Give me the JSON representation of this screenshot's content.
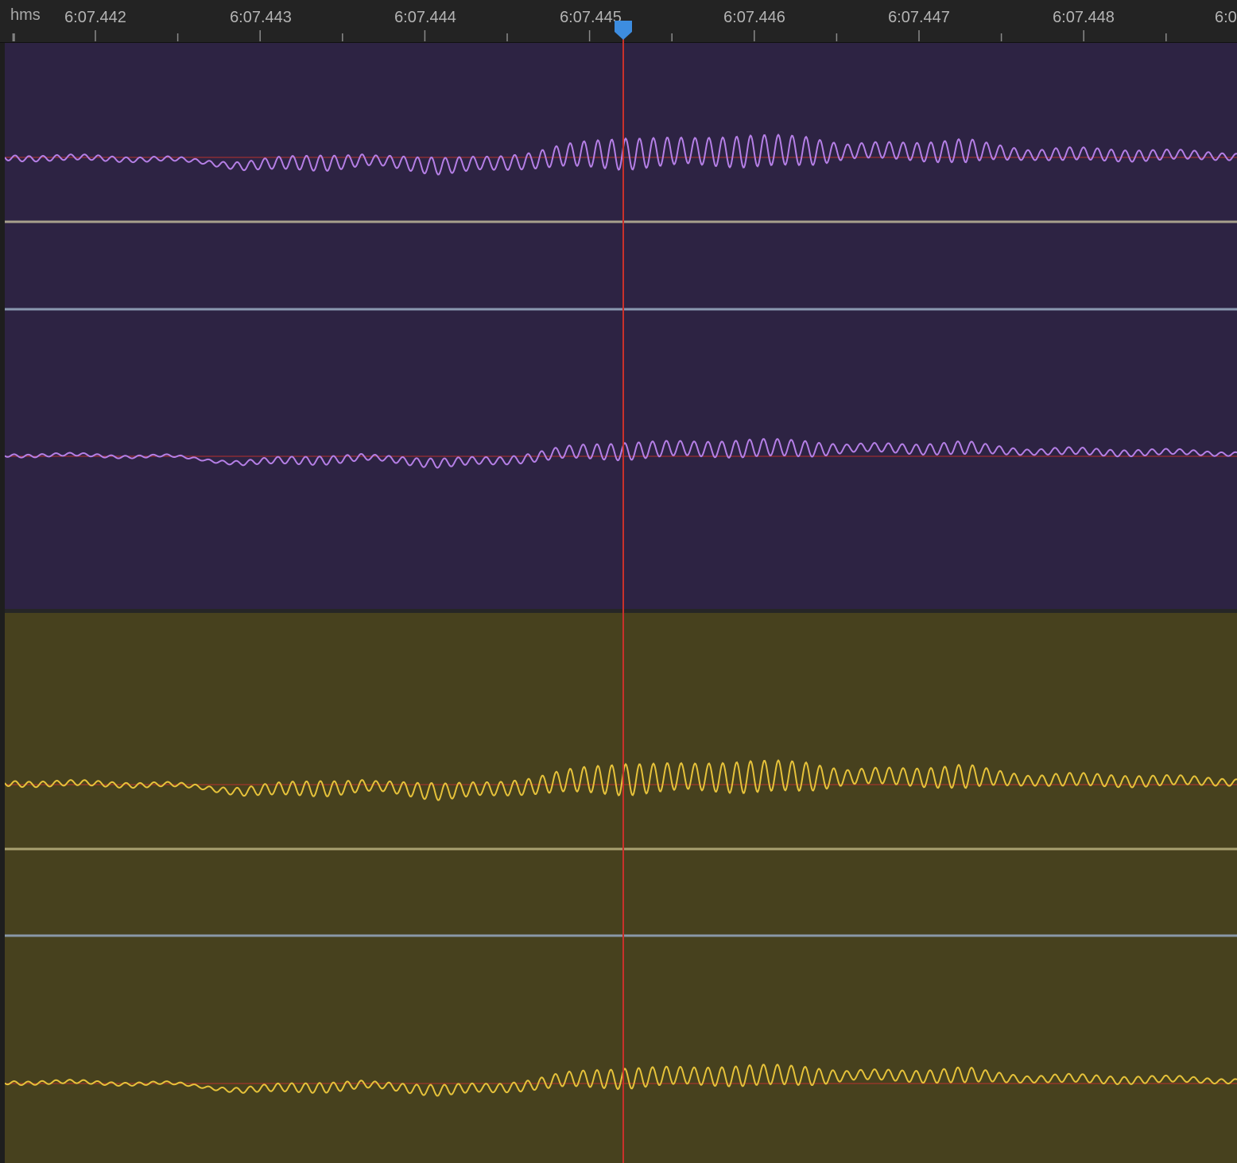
{
  "ruler": {
    "unit_label": "hms",
    "ticks": [
      "6:07.442",
      "6:07.443",
      "6:07.444",
      "6:07.445",
      "6:07.446",
      "6:07.447",
      "6:07.448",
      "6:0"
    ]
  },
  "colors": {
    "purple_track_bg": "#2d2343",
    "purple_wave": "#b57fe6",
    "olive_track_bg": "#47411e",
    "olive_wave": "#e6c23a",
    "playhead": "#c9312b",
    "playhead_handle": "#3d8de0"
  },
  "icons": {
    "playhead": "playhead-marker-icon"
  }
}
